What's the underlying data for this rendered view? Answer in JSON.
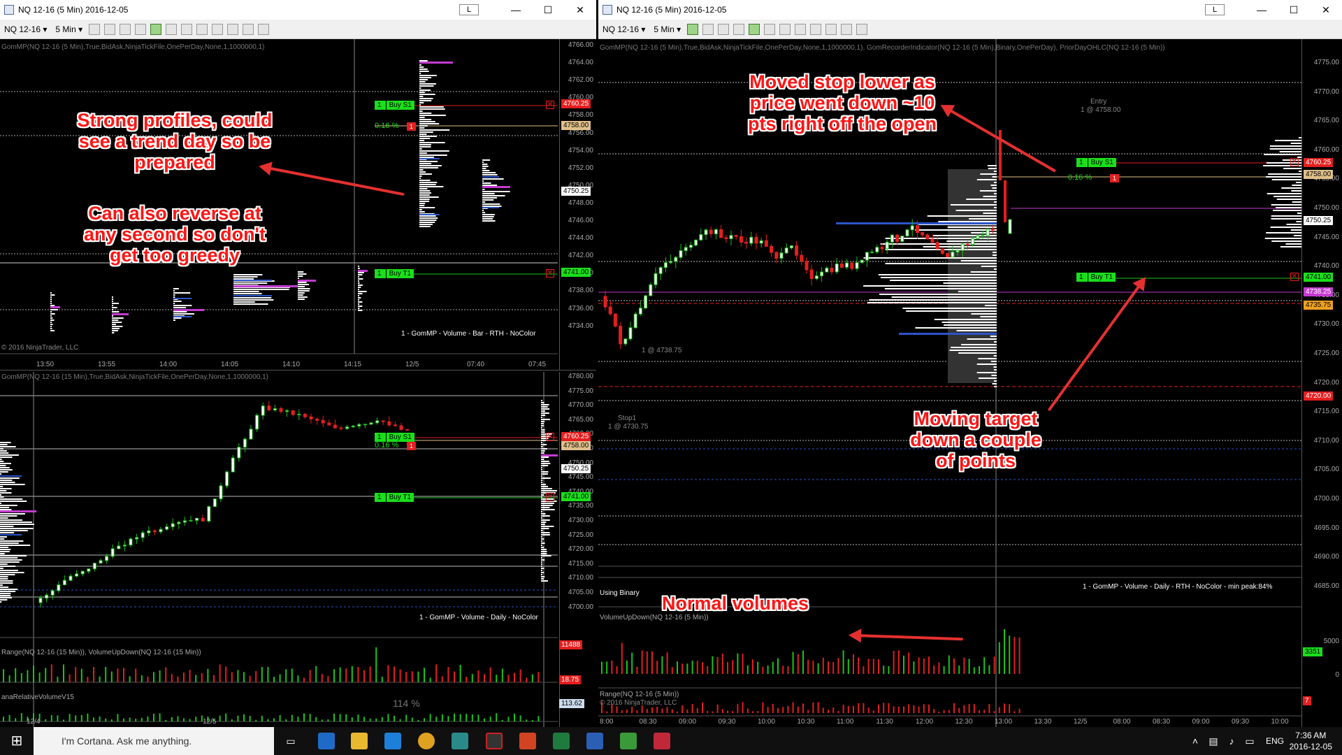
{
  "left_window": {
    "title": "NQ 12-16 (5 Min)  2016-12-05",
    "l_button": "L",
    "instrument": "NQ 12-16",
    "period": "5 Min"
  },
  "right_window": {
    "title": "NQ 12-16 (5 Min)  2016-12-05",
    "l_button": "L",
    "instrument": "NQ 12-16",
    "period": "5 Min"
  },
  "window_buttons": {
    "minimize": "—",
    "maximize": "☐",
    "close": "✕"
  },
  "dropdown_arrow": "▾",
  "top_left_panel": {
    "indicator": "GomMP(NQ 12-16 (5 Min),True,BidAsk,NinjaTickFile,OnePerDay,None,1,1000000,1)",
    "copyright": "© 2016 NinjaTrader, LLC",
    "footer": "1 - GomMP  - Volume - Bar - RTH - NoColor",
    "prices": [
      "4766.00",
      "4764.00",
      "4762.00",
      "4760.00",
      "4758.00",
      "4756.00",
      "4754.00",
      "4752.00",
      "4750.00",
      "4748.00",
      "4746.00",
      "4744.00",
      "4742.00",
      "4740.00",
      "4738.00",
      "4736.00",
      "4734.00"
    ],
    "buy_s1": {
      "qty": "1",
      "label": "Buy S1",
      "price": "4760.25"
    },
    "pct": "0.16 %",
    "pct_box": "1",
    "mid_price": "4758.00",
    "last_price": "4750.25",
    "buy_t1": {
      "qty": "1",
      "label": "Buy T1",
      "price": "4741.00"
    },
    "times": [
      "13:50",
      "13:55",
      "14:00",
      "14:05",
      "14:10",
      "14:15",
      "12/5",
      "07:40",
      "07:45"
    ]
  },
  "bottom_left_panel": {
    "indicator": "GomMP(NQ 12-16 (15 Min),True,BidAsk,NinjaTickFile,OnePerDay,None,1,1000000,1)",
    "prices": [
      "4780.00",
      "4775.00",
      "4770.00",
      "4765.00",
      "4760.00",
      "4755.00",
      "4750.00",
      "4745.00",
      "4740.00",
      "4735.00",
      "4730.00",
      "4725.00",
      "4720.00",
      "4715.00",
      "4710.00",
      "4705.00",
      "4700.00"
    ],
    "footer": "1 - GomMP  - Volume - Daily - NoColor",
    "buy_s1": {
      "qty": "1",
      "label": "Buy S1",
      "price": "4760.25"
    },
    "pct": "0.16 %",
    "pct_box": "1",
    "mid_price": "4758.00",
    "last_price": "4750.25",
    "buy_t1": {
      "qty": "1",
      "label": "Buy T1",
      "price": "4741.00"
    },
    "sub1_label": "Range(NQ 12-16 (15 Min)), VolumeUpDown(NQ 12-16 (15 Min))",
    "sub1_value": "11488",
    "sub1_value2": "18.75",
    "sub2_label": "anaRelativeVolumeV15",
    "sub2_pct": "114 %",
    "sub2_value": "113.62",
    "dates": [
      "12/4",
      "12/5"
    ]
  },
  "right_panel": {
    "indicator": "GomMP(NQ 12-16 (5 Min),True,BidAsk,NinjaTickFile,OnePerDay,None,1,1000000,1), GomRecorderIndicator(NQ 12-16 (5 Min),Binary,OnePerDay), PriorDayOHLC(NQ 12-16 (5 Min))",
    "prices": [
      "4775.00",
      "4770.00",
      "4765.00",
      "4760.00",
      "4755.00",
      "4750.00",
      "4745.00",
      "4740.00",
      "4735.00",
      "4730.00",
      "4725.00",
      "4720.00",
      "4715.00",
      "4710.00",
      "4705.00",
      "4700.00",
      "4695.00",
      "4690.00",
      "4685.00"
    ],
    "buy_s1": {
      "qty": "1",
      "label": "Buy S1",
      "price": "4760.25"
    },
    "pct": "0.16 %",
    "pct_box": "1",
    "price_mid": "4758.00",
    "last_price": "4750.25",
    "buy_t1": {
      "qty": "1",
      "label": "Buy T1",
      "price": "4741.00"
    },
    "price_mag": "4738.25",
    "price_orange": "4735.75",
    "price_red": "4720.00",
    "entry_label": "Entry",
    "entry_fill": "1 @ 4758.00",
    "stop_label": "Stop1",
    "stop_fill": "1 @ 4730.75",
    "stop2": "1 @ 4738.75",
    "footer": "1 - GomMP  - Volume - Daily - RTH - NoColor - min peak:84%",
    "binary": "Using Binary",
    "vol_label": "VolumeUpDown(NQ 12-16 (5 Min))",
    "vol_ticks": [
      "5000",
      "0"
    ],
    "vol_value": "3351",
    "range_label": "Range(NQ 12-16 (5 Min))",
    "range_copyright": "© 2016 NinjaTrader, LLC",
    "range_value": "7",
    "times": [
      "8:00",
      "08:30",
      "09:00",
      "09:30",
      "10:00",
      "10:30",
      "11:00",
      "11:30",
      "12:00",
      "12:30",
      "13:00",
      "13:30",
      "12/5",
      "08:00",
      "08:30",
      "09:00",
      "09:30",
      "10:00"
    ]
  },
  "annotations": {
    "a1": "Strong profiles, could see a trend day so be prepared",
    "a2": "Can also reverse at any second so don't get too greedy",
    "a3": "Moved stop lower as price went down ~10 pts right off the open",
    "a4": "Moving target down a couple of points",
    "a5": "Normal volumes"
  },
  "taskbar": {
    "search": "I'm Cortana. Ask me anything.",
    "lang": "ENG",
    "time": "7:36 AM",
    "date": "2016-12-05"
  },
  "colors": {
    "buy": "#19e019",
    "stop": "#e51e1e",
    "profile": "#ffffff",
    "poc": "#c43bd0",
    "va": "#2a55c8"
  }
}
